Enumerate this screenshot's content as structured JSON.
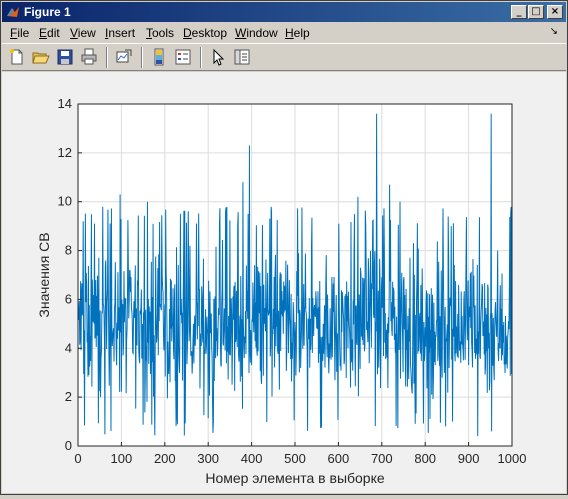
{
  "window": {
    "title": "Figure 1",
    "minimize_glyph": "_",
    "maximize_glyph": "□",
    "close_glyph": "×"
  },
  "menu": {
    "items": [
      {
        "mnemonic": "F",
        "rest": "ile"
      },
      {
        "mnemonic": "E",
        "rest": "dit"
      },
      {
        "mnemonic": "V",
        "rest": "iew"
      },
      {
        "mnemonic": "I",
        "rest": "nsert"
      },
      {
        "mnemonic": "T",
        "rest": "ools"
      },
      {
        "mnemonic": "D",
        "rest": "esktop"
      },
      {
        "mnemonic": "W",
        "rest": "indow"
      },
      {
        "mnemonic": "H",
        "rest": "elp"
      }
    ],
    "dock_arrow": "↘"
  },
  "toolbar": {
    "icons": [
      "new-figure-icon",
      "open-file-icon",
      "save-figure-icon",
      "print-icon",
      "link-plot-icon",
      "insert-colorbar-icon",
      "insert-legend-icon",
      "edit-plot-pointer-icon",
      "property-inspector-icon"
    ]
  },
  "colors": {
    "line": "#0072bd",
    "grid": "#dcdcdc",
    "axes_bg": "#ffffff",
    "figure_bg": "#f0f0f0"
  },
  "chart_data": {
    "type": "line",
    "title": "",
    "xlabel": "Номер элемента в выборке",
    "ylabel": "Значения СВ",
    "xlim": [
      0,
      1000
    ],
    "ylim": [
      0,
      14
    ],
    "xticks": [
      "0",
      "100",
      "200",
      "300",
      "400",
      "500",
      "600",
      "700",
      "800",
      "900",
      "1000"
    ],
    "yticks": [
      "0",
      "2",
      "4",
      "6",
      "8",
      "10",
      "12",
      "14"
    ],
    "grid": true,
    "series": [
      {
        "n_points": 1000,
        "typical_range": [
          1,
          9
        ],
        "peaks": [
          {
            "x": 395,
            "y": 12.3
          },
          {
            "x": 688,
            "y": 13.6
          },
          {
            "x": 952,
            "y": 13.6
          },
          {
            "x": 97,
            "y": 10.3
          },
          {
            "x": 380,
            "y": 10.8
          },
          {
            "x": 160,
            "y": 10.0
          },
          {
            "x": 645,
            "y": 10.2
          },
          {
            "x": 742,
            "y": 10.0
          },
          {
            "x": 718,
            "y": 10.7
          }
        ]
      }
    ]
  }
}
